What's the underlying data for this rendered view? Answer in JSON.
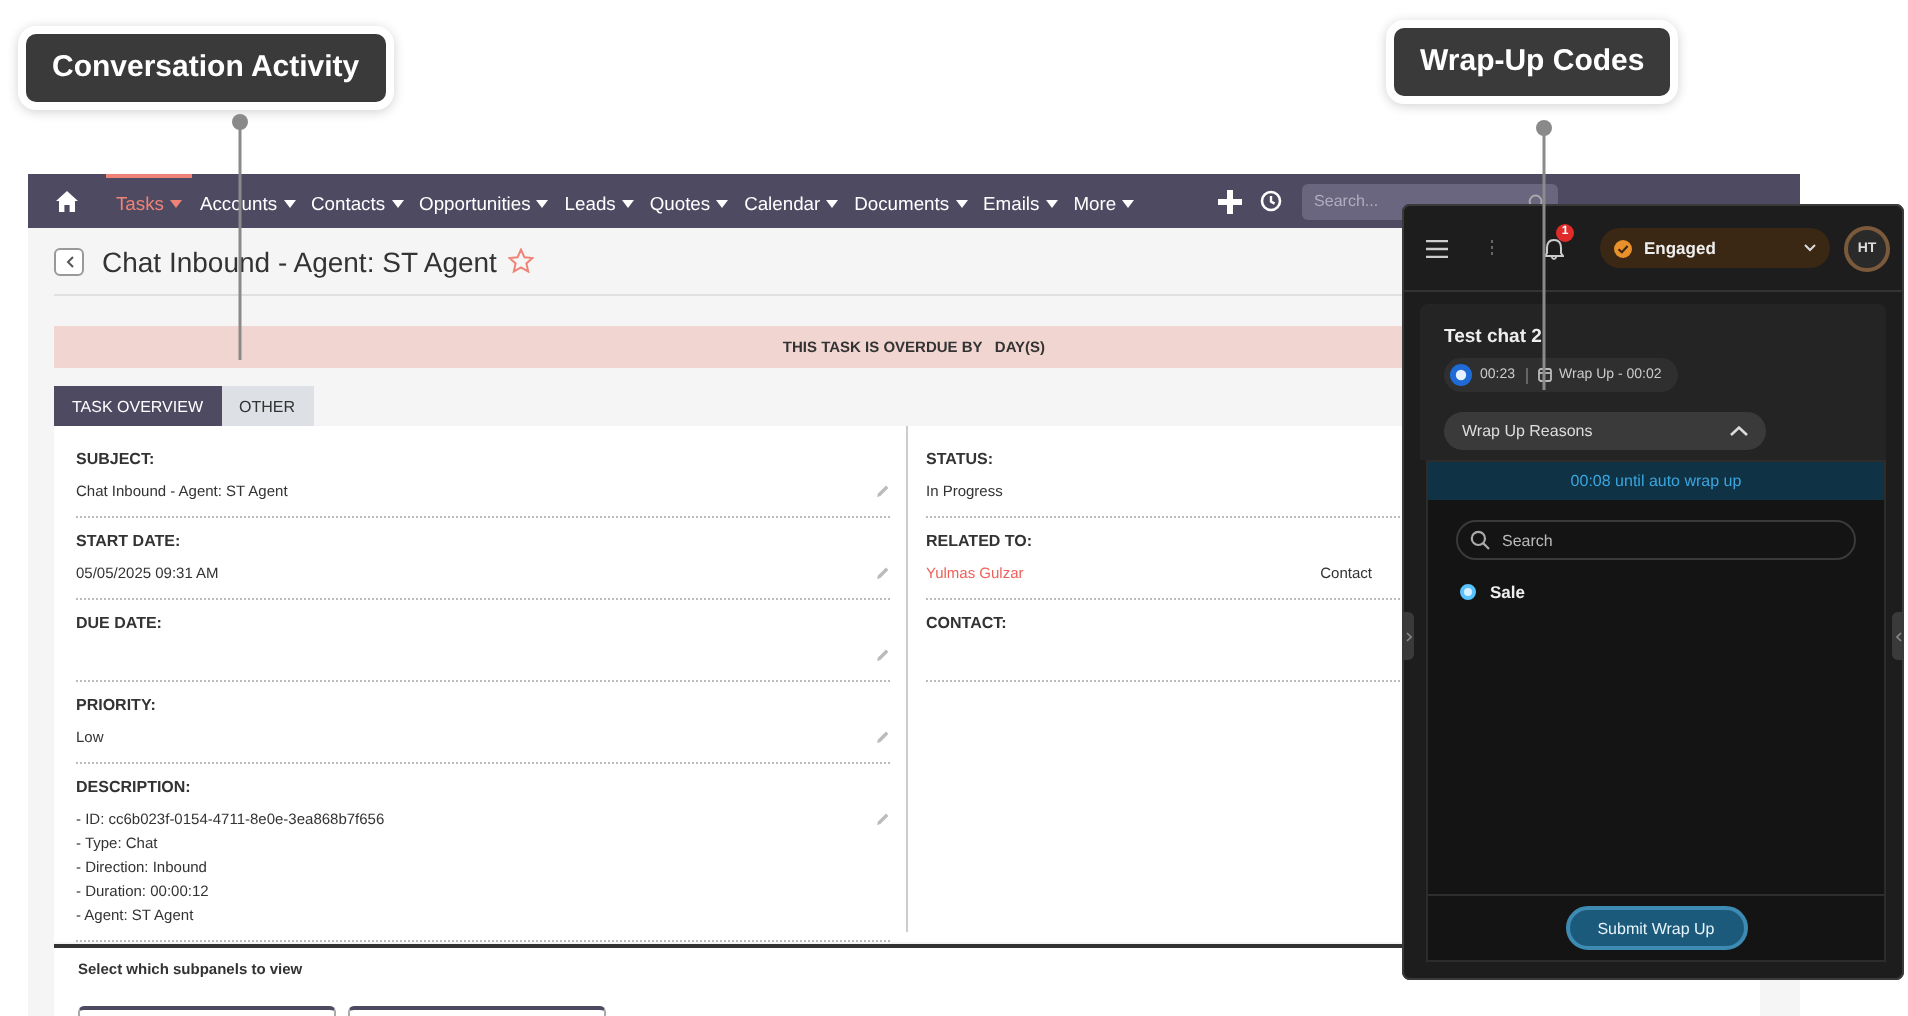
{
  "callouts": [
    {
      "label": "Conversation Activity"
    },
    {
      "label": "Wrap-Up Codes"
    }
  ],
  "crm": {
    "nav": {
      "items": [
        {
          "label": "Tasks",
          "selected": true
        },
        {
          "label": "Accounts",
          "selected": false
        },
        {
          "label": "Contacts",
          "selected": false
        },
        {
          "label": "Opportunities",
          "selected": false
        },
        {
          "label": "Leads",
          "selected": false
        },
        {
          "label": "Quotes",
          "selected": false
        },
        {
          "label": "Calendar",
          "selected": false
        },
        {
          "label": "Documents",
          "selected": false
        },
        {
          "label": "Emails",
          "selected": false
        },
        {
          "label": "More",
          "selected": false
        }
      ],
      "search": {
        "placeholder": "Search..."
      }
    },
    "record": {
      "title": "Chat Inbound - Agent: ST Agent",
      "favorite": false
    },
    "alert": {
      "text": "THIS TASK IS OVERDUE BY   DAY(S)"
    },
    "tabs": [
      {
        "label": "TASK OVERVIEW",
        "selected": true
      },
      {
        "label": "OTHER",
        "selected": false
      }
    ],
    "left_fields": [
      {
        "label": "SUBJECT:",
        "lines": [
          "Chat Inbound - Agent: ST Agent"
        ]
      },
      {
        "label": "START DATE:",
        "lines": [
          "05/05/2025 09:31 AM"
        ]
      },
      {
        "label": "DUE DATE:"
      },
      {
        "label": "PRIORITY:",
        "lines": [
          "Low"
        ]
      },
      {
        "label": "DESCRIPTION:",
        "lines": [
          "- ID: cc6b023f-0154-4711-8e0e-3ea868b7f656",
          "- Type: Chat",
          "- Direction: Inbound",
          "- Duration: 00:00:12",
          "- Agent: ST Agent"
        ]
      }
    ],
    "right_fields": [
      {
        "label": "STATUS:",
        "value": "In Progress"
      },
      {
        "label": "RELATED TO:",
        "link": "Yulmas Gulzar",
        "type": "Contact"
      },
      {
        "label": "CONTACT:"
      }
    ],
    "subpanels": {
      "title": "Select which subpanels to view"
    }
  },
  "softphone": {
    "notifications": "1",
    "status": {
      "label": "Engaged"
    },
    "avatar": "HT",
    "interaction": {
      "title": "Test chat 2",
      "duration": "00:23",
      "wrapup": "Wrap Up - 00:02"
    },
    "reasons": {
      "label": "Wrap Up Reasons",
      "expanded": true,
      "countdown": "00:08 until auto wrap up",
      "search_placeholder": "Search",
      "options": [
        {
          "label": "Sale",
          "selected": true
        }
      ],
      "submit": "Submit Wrap Up"
    }
  }
}
